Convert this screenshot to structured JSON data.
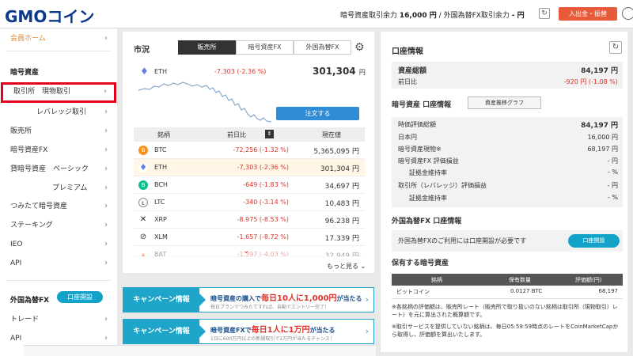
{
  "header": {
    "logo": "GMOコイン",
    "trade_power_label": "暗号資産取引余力",
    "trade_power_value": "16,000 円",
    "separator": "/",
    "fx_power_label": "外国為替FX取引余力",
    "fx_power_value": "- 円",
    "deposit_button": "入出金・振替"
  },
  "sidebar": {
    "home": "会員ホーム",
    "crypto_section": "暗号資産",
    "items": [
      {
        "label": "取引所　現物取引"
      },
      {
        "label": "レバレッジ取引"
      },
      {
        "label": "販売所"
      },
      {
        "label": "暗号資産FX"
      },
      {
        "label": "貸暗号資産　ベーシック"
      },
      {
        "label": "プレミアム"
      },
      {
        "label": "つみたて暗号資産"
      },
      {
        "label": "ステーキング"
      },
      {
        "label": "IEO"
      },
      {
        "label": "API"
      }
    ],
    "fx_section": "外国為替FX",
    "fx_open_button": "口座開設",
    "fx_items": [
      {
        "label": "トレード"
      },
      {
        "label": "API"
      }
    ]
  },
  "market": {
    "title": "市況",
    "tabs": [
      "販売所",
      "暗号資産FX",
      "外国為替FX"
    ],
    "featured": {
      "name": "ETH",
      "change": "-7,303 (-2.36 %)",
      "price": "301,304",
      "unit": "円"
    },
    "order_button": "注文する",
    "columns": [
      "銘柄",
      "前日比",
      "現在値"
    ],
    "rows": [
      {
        "symbol": "BTC",
        "change": "-72,256 (-1.32 %)",
        "price": "5,365,095 円",
        "icon": "B",
        "color": "#f7931a"
      },
      {
        "symbol": "ETH",
        "change": "-7,303 (-2.36 %)",
        "price": "301,304 円",
        "icon": "♦",
        "color": "#627eea"
      },
      {
        "symbol": "BCH",
        "change": "-649 (-1.83 %)",
        "price": "34,697 円",
        "icon": "B",
        "color": "#0ac18e"
      },
      {
        "symbol": "LTC",
        "change": "-340 (-3.14 %)",
        "price": "10,483 円",
        "icon": "Ł",
        "color": "#8a8a8a"
      },
      {
        "symbol": "XRP",
        "change": "-8.975 (-8.53 %)",
        "price": "96.238 円",
        "icon": "✕",
        "color": "#222222"
      },
      {
        "symbol": "XLM",
        "change": "-1.657 (-8.72 %)",
        "price": "17.339 円",
        "icon": "⊘",
        "color": "#333333"
      },
      {
        "symbol": "BAT",
        "change": "-1,397 (-4.03 %)",
        "price": "32.949 円",
        "icon": "▲",
        "color": "#ff5000"
      }
    ],
    "more": "もっと見る"
  },
  "campaigns": [
    {
      "tag": "キャンペーン情報",
      "line1_pre": "暗号資産の購入で",
      "line1_hl": "毎日10人に1,000円",
      "line1_post": "が当たる",
      "line2": "毎日プランでつみたてすれば、自動でエントリー完了！"
    },
    {
      "tag": "キャンペーン情報",
      "line1_pre": "暗号資産FXで",
      "line1_hl": "毎日1人に1万円",
      "line1_post": "が当たる",
      "line2": "1日に600万円以上の新規取引で1万円が当たるチャンス！"
    }
  ],
  "account": {
    "title": "口座情報",
    "total_label": "資産総額",
    "total_value": "84,197 円",
    "prev_label": "前日比",
    "prev_value": "-920 円 (-1.08 %)",
    "crypto_title": "暗号資産 口座情報",
    "graph_button": "資産推移グラフ",
    "rows": [
      {
        "label": "時価評価総額",
        "value": "84,197 円"
      },
      {
        "label": "日本円",
        "value": "16,000 円"
      },
      {
        "label": "暗号資産現物※",
        "value": "68,197 円"
      },
      {
        "label": "暗号資産FX 評価損益",
        "value": "- 円"
      },
      {
        "label": "証拠金維持率",
        "value": "- %"
      },
      {
        "label": "取引所（レバレッジ）評価損益",
        "value": "- 円"
      },
      {
        "label": "証拠金維持率",
        "value": "- %"
      }
    ],
    "fx_title": "外国為替FX 口座情報",
    "fx_msg": "外国為替FXのご利用には口座開設が必要です",
    "fx_open": "口座開設",
    "hold_title": "保有する暗号資産",
    "hold_columns": [
      "銘柄",
      "保有数量",
      "評価額(円)"
    ],
    "hold_rows": [
      {
        "name": "ビットコイン",
        "qty": "0.0127 BTC",
        "value": "68,197"
      }
    ],
    "note1": "※各銘柄の評価額は、販売所レート（販売所で取り扱いのない銘柄は取引所（現物取引）レート）を元に算出された概算額です。",
    "note2": "※取引サービスを提供していない銘柄は、毎日05:59:59時点のレートをCoinMarketCapから取得し、評価額を算出いたします。"
  }
}
